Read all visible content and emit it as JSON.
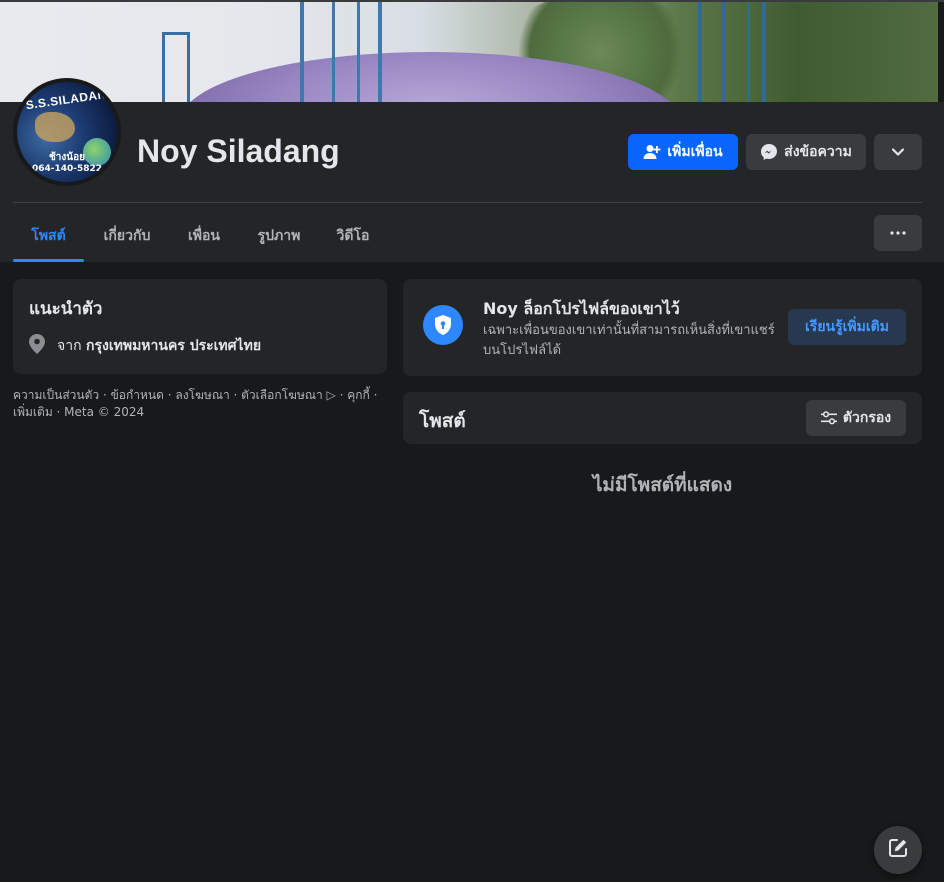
{
  "profile": {
    "name": "Noy Siladang",
    "avatar_lines": [
      "S.S.SILADANG",
      "ช้างน้อย",
      "064-140-5822"
    ]
  },
  "actions": {
    "add_friend": "เพิ่มเพื่อน",
    "message": "ส่งข้อความ"
  },
  "tabs": [
    {
      "label": "โพสต์",
      "active": true
    },
    {
      "label": "เกี่ยวกับ",
      "active": false
    },
    {
      "label": "เพื่อน",
      "active": false
    },
    {
      "label": "รูปภาพ",
      "active": false
    },
    {
      "label": "วิดีโอ",
      "active": false
    }
  ],
  "intro": {
    "title": "แนะนำตัว",
    "location_prefix": "จาก",
    "location": "กรุงเทพมหานคร ประเทศไทย"
  },
  "footer": {
    "text": "ความเป็นส่วนตัว · ข้อกำหนด · ลงโฆษณา · ตัวเลือกโฆษณา ▷ · คุกกี้ · เพิ่มเติม · Meta © 2024"
  },
  "locked_notice": {
    "title": "Noy ล็อกโปรไฟล์ของเขาไว้",
    "body": "เฉพาะเพื่อนของเขาเท่านั้นที่สามารถเห็นสิ่งที่เขาแชร์บนโปรไฟล์ได้",
    "learn_more": "เรียนรู้เพิ่มเติม"
  },
  "posts": {
    "title": "โพสต์",
    "filter": "ตัวกรอง",
    "empty": "ไม่มีโพสต์ที่แสดง"
  },
  "colors": {
    "accent": "#0866ff",
    "tab_active": "#2d88ff",
    "background": "#18191a",
    "card": "#242526"
  },
  "icons": [
    "add-friend-icon",
    "messenger-icon",
    "chevron-down-icon",
    "more-dots-icon",
    "location-pin-icon",
    "shield-lock-icon",
    "filter-icon",
    "compose-icon"
  ]
}
